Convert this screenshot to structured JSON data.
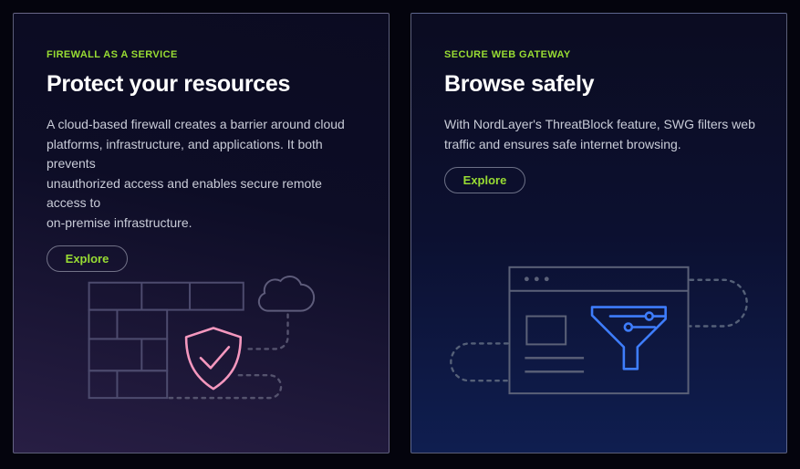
{
  "colors": {
    "accent_green": "#98dc33",
    "shield_pink": "#f497be",
    "funnel_blue": "#3e7dfc",
    "card_background_top": "#0c0c24",
    "card_faas_bottom": "#281e44",
    "card_swg_bottom": "#0f1e50",
    "page_background": "#04040d"
  },
  "cards": [
    {
      "eyebrow": "FIREWALL AS A SERVICE",
      "title": "Protect your resources",
      "description": "A cloud-based firewall creates a barrier around cloud\nplatforms, infrastructure, and applications. It both prevents\nunauthorized access and enables secure remote access to\non-premise infrastructure.",
      "cta": "Explore",
      "illustration": "brick wall with pink shield check, cloud and dashed connector"
    },
    {
      "eyebrow": "SECURE WEB GATEWAY",
      "title": "Browse safely",
      "description": "With NordLayer's ThreatBlock feature, SWG filters web\ntraffic and ensures safe internet browsing.",
      "cta": "Explore",
      "illustration": "browser window with blue filter funnel and dashed loops"
    }
  ]
}
